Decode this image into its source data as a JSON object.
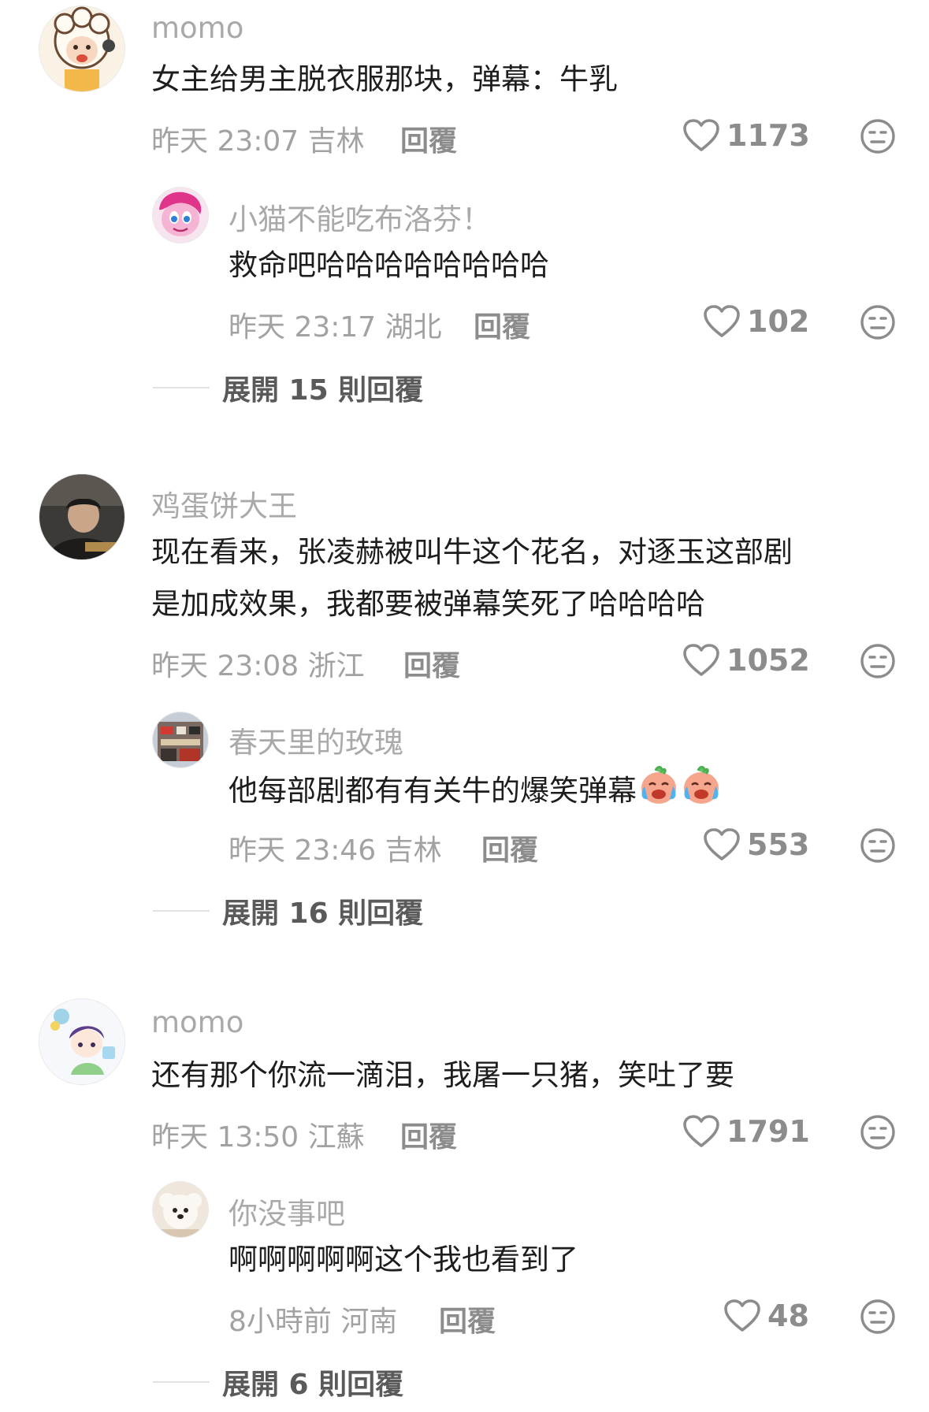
{
  "comments": [
    {
      "user": "momo",
      "text": "女主给男主脱衣服那块，弹幕：牛乳",
      "meta": "昨天 23:07 吉林",
      "reply_label": "回覆",
      "likes": "1173",
      "avatar_icon": "cartoon-sheep-avatar",
      "replies": [
        {
          "user": "小猫不能吃布洛芬！",
          "text": "救命吧哈哈哈哈哈哈哈哈",
          "meta": "昨天 23:17 湖北",
          "reply_label": "回覆",
          "likes": "102",
          "avatar_icon": "pink-pony-avatar"
        }
      ],
      "expand_label": "展開 15 則回覆"
    },
    {
      "user": "鸡蛋饼大王",
      "text_lines": [
        "现在看来，张凌赫被叫牛这个花名，对逐玉这部剧",
        "是加成效果，我都要被弹幕笑死了哈哈哈哈"
      ],
      "meta": "昨天 23:08 浙江",
      "reply_label": "回覆",
      "likes": "1052",
      "avatar_icon": "photo-person-avatar",
      "replies": [
        {
          "user": "春天里的玫瑰",
          "text": "他每部剧都有有关牛的爆笑弹幕",
          "emoji": "crying-laugh-emoji",
          "meta": "昨天 23:46 吉林",
          "reply_label": "回覆",
          "likes": "553",
          "avatar_icon": "street-photo-avatar"
        }
      ],
      "expand_label": "展開 16 則回覆"
    },
    {
      "user": "momo",
      "text": "还有那个你流一滴泪，我屠一只猪，笑吐了要",
      "meta": "昨天 13:50 江蘇",
      "reply_label": "回覆",
      "likes": "1791",
      "avatar_icon": "anime-character-avatar",
      "replies": [
        {
          "user": "你没事吧",
          "text": "啊啊啊啊啊这个我也看到了",
          "meta": "8小時前 河南",
          "reply_label": "回覆",
          "likes": "48",
          "avatar_icon": "white-puppy-avatar"
        }
      ],
      "expand_label": "展開 6 則回覆"
    }
  ],
  "colors": {
    "background": "#ffffff",
    "username": "#a9a9a9",
    "body_text": "#1d1d1d",
    "meta_text": "#a2a2a2",
    "action_text": "#8c8c8c"
  },
  "icons": {
    "like": "heart-outline-icon",
    "dislike": "meh-face-icon"
  }
}
